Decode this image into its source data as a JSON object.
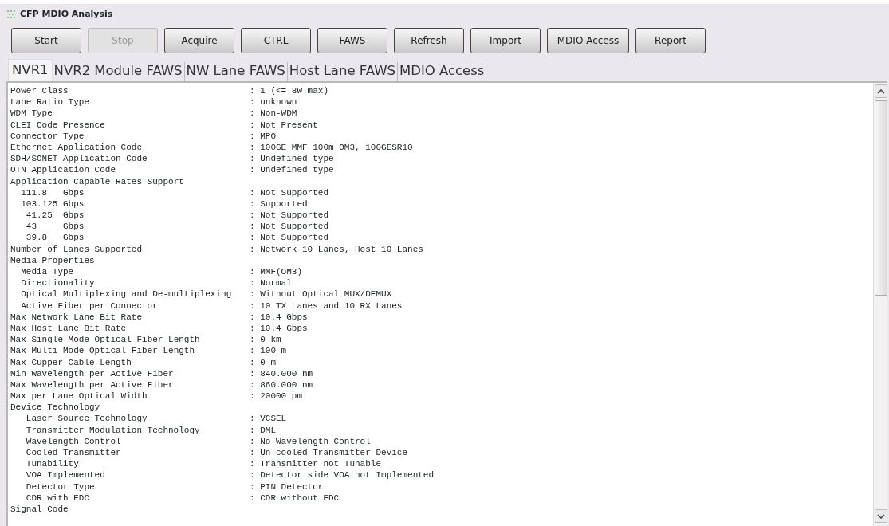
{
  "window": {
    "title": "CFP MDIO Analysis"
  },
  "toolbar": [
    {
      "label": "Start",
      "disabled": false
    },
    {
      "label": "Stop",
      "disabled": true
    },
    {
      "label": "Acquire",
      "disabled": false
    },
    {
      "label": "CTRL",
      "disabled": false
    },
    {
      "label": "FAWS",
      "disabled": false
    },
    {
      "label": "Refresh",
      "disabled": false
    },
    {
      "label": "Import",
      "disabled": false
    },
    {
      "label": "MDIO Access",
      "disabled": false
    },
    {
      "label": "Report",
      "disabled": false
    }
  ],
  "tabs": [
    {
      "label": "NVR1",
      "selected": true
    },
    {
      "label": "NVR2",
      "selected": false
    },
    {
      "label": "Module FAWS",
      "selected": false
    },
    {
      "label": "NW Lane FAWS",
      "selected": false
    },
    {
      "label": "Host Lane FAWS",
      "selected": false
    },
    {
      "label": "MDIO Access",
      "selected": false
    }
  ],
  "report": [
    {
      "label": "Power Class",
      "value": ": 1 (<= 8W max)"
    },
    {
      "label": "Lane Ratio Type",
      "value": ": unknown"
    },
    {
      "label": "WDM Type",
      "value": ": Non-WDM"
    },
    {
      "label": "CLEI Code Presence",
      "value": ": Not Present"
    },
    {
      "label": "Connector Type",
      "value": ": MPO"
    },
    {
      "label": "Ethernet Application Code",
      "value": ": 100GE MMF 100m OM3, 100GESR10"
    },
    {
      "label": "SDH/SONET Application Code",
      "value": ": Undefined type"
    },
    {
      "label": "OTN Application Code",
      "value": ": Undefined type"
    },
    {
      "label": "Application Capable Rates Support",
      "children": [
        {
          "label": "111.8   Gbps",
          "value": ": Not Supported"
        },
        {
          "label": "103.125 Gbps",
          "value": ": Supported"
        },
        {
          "label": " 41.25  Gbps",
          "value": ": Not Supported"
        },
        {
          "label": " 43     Gbps",
          "value": ": Not Supported"
        },
        {
          "label": " 39.8   Gbps",
          "value": ": Not Supported"
        }
      ]
    },
    {
      "label": "Number of Lanes Supported",
      "value": ": Network 10 Lanes, Host 10 Lanes"
    },
    {
      "label": "Media Properties",
      "children": [
        {
          "label": "Media Type",
          "value": ": MMF(OM3)"
        },
        {
          "label": "Directionality",
          "value": ": Normal"
        },
        {
          "label": "Optical Multiplexing and De-multiplexing",
          "value": ": Without Optical MUX/DEMUX"
        },
        {
          "label": "Active Fiber per Connector",
          "value": ": 10 TX Lanes and 10 RX Lanes"
        }
      ]
    },
    {
      "label": "Max Network Lane Bit Rate",
      "value": ": 10.4 Gbps"
    },
    {
      "label": "Max Host Lane Bit Rate",
      "value": ": 10.4 Gbps"
    },
    {
      "label": "Max Single Mode Optical Fiber Length",
      "value": ": 0 km"
    },
    {
      "label": "Max Multi Mode Optical Fiber Length",
      "value": ": 100 m"
    },
    {
      "label": "Max Cupper Cable Length",
      "value": ": 0 m"
    },
    {
      "label": "Min Wavelength per Active Fiber",
      "value": ": 840.000 nm"
    },
    {
      "label": "Max Wavelength per Active Fiber",
      "value": ": 860.000 nm"
    },
    {
      "label": "Max per Lane Optical Width",
      "value": ": 20000 pm"
    },
    {
      "label": "Device Technology",
      "children": [
        {
          "label": " Laser Source Technology",
          "value": ": VCSEL"
        },
        {
          "label": " Transmitter Modulation Technology",
          "value": ": DML"
        },
        {
          "label": " Wavelength Control",
          "value": ": No Wavelength Control"
        },
        {
          "label": " Cooled Transmitter",
          "value": ": Un-cooled Transmitter Device"
        },
        {
          "label": " Tunability",
          "value": ": Transmitter not Tunable"
        },
        {
          "label": " VOA Implemented",
          "value": ": Detector side VOA not Implemented"
        },
        {
          "label": " Detector Type",
          "value": ": PIN Detector"
        },
        {
          "label": " CDR with EDC",
          "value": ": CDR without EDC"
        }
      ]
    },
    {
      "label": "Signal Code"
    }
  ]
}
